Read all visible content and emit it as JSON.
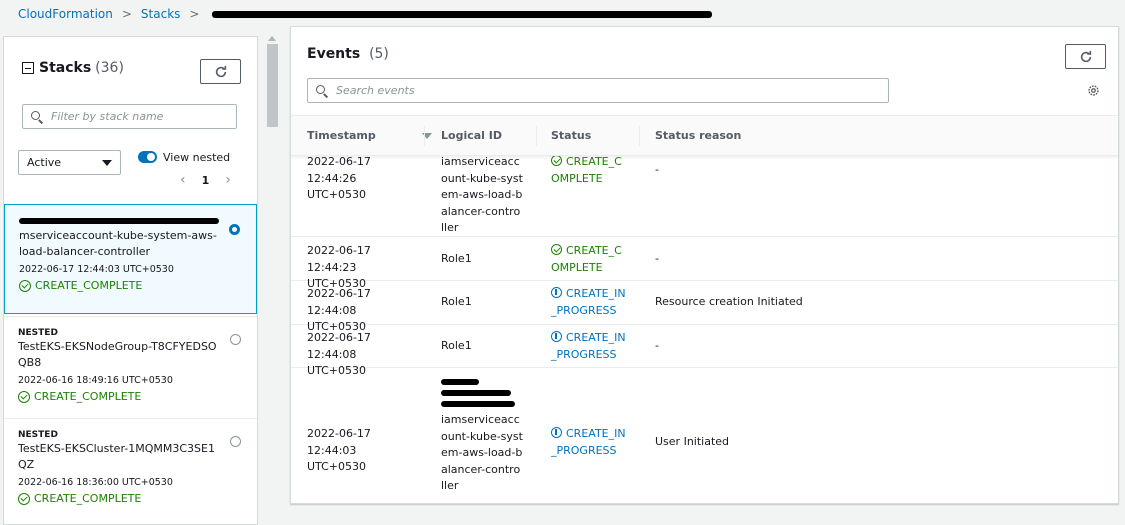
{
  "breadcrumb": {
    "root": "CloudFormation",
    "section": "Stacks"
  },
  "stacks_panel": {
    "title": "Stacks",
    "count": "(36)",
    "filter_placeholder": "Filter by stack name",
    "status_filter": "Active",
    "view_nested_label": "View nested",
    "page": "1",
    "items": [
      {
        "name": "mserviceaccount-kube-system-aws-load-balancer-controller",
        "timestamp": "2022-06-17 12:44:03 UTC+0530",
        "status": "CREATE_COMPLETE"
      },
      {
        "tag": "NESTED",
        "name": "TestEKS-EKSNodeGroup-T8CFYEDSOQB8",
        "timestamp": "2022-06-16 18:49:16 UTC+0530",
        "status": "CREATE_COMPLETE"
      },
      {
        "tag": "NESTED",
        "name": "TestEKS-EKSCluster-1MQMM3C3SE1QZ",
        "timestamp": "2022-06-16 18:36:00 UTC+0530",
        "status": "CREATE_COMPLETE"
      }
    ]
  },
  "events_panel": {
    "title": "Events",
    "count": "(5)",
    "search_placeholder": "Search events",
    "columns": {
      "timestamp": "Timestamp",
      "logical_id": "Logical ID",
      "status": "Status",
      "status_reason": "Status reason"
    },
    "rows": [
      {
        "date": "2022-06-17",
        "time": "12:44:26 UTC+0530",
        "logical_id": "iamserviceaccount-kube-system-aws-load-balancer-controller",
        "status": "CREATE_COMPLETE",
        "reason": "-"
      },
      {
        "date": "2022-06-17",
        "time": "12:44:23 UTC+0530",
        "logical_id": "Role1",
        "status": "CREATE_COMPLETE",
        "reason": "-"
      },
      {
        "date": "2022-06-17",
        "time": "12:44:08 UTC+0530",
        "logical_id": "Role1",
        "status": "CREATE_IN_PROGRESS",
        "reason": "Resource creation Initiated"
      },
      {
        "date": "2022-06-17",
        "time": "12:44:08 UTC+0530",
        "logical_id": "Role1",
        "status": "CREATE_IN_PROGRESS",
        "reason": "-"
      },
      {
        "date": "2022-06-17",
        "time": "12:44:03 UTC+0530",
        "logical_id": "iamserviceaccount-kube-system-aws-load-balancer-controller",
        "status": "CREATE_IN_PROGRESS",
        "reason": "User Initiated"
      }
    ]
  },
  "colors": {
    "link": "#0073bb",
    "success": "#1d8102",
    "info": "#0073bb",
    "selected_border": "#00a1c9"
  }
}
